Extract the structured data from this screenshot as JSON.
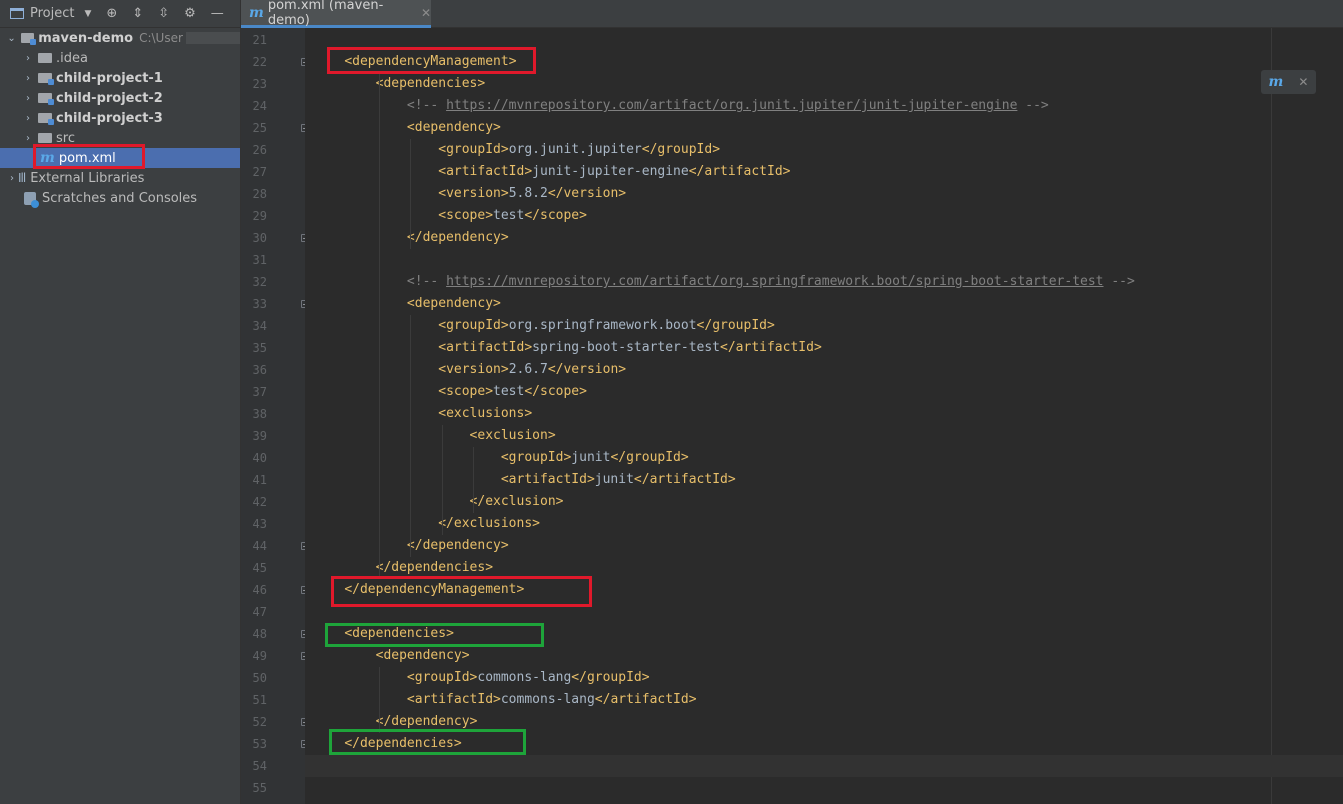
{
  "sidebar": {
    "header": {
      "title": "Project"
    },
    "root": {
      "name": "maven-demo",
      "path": "C:\\User"
    },
    "items": [
      {
        "label": ".idea"
      },
      {
        "label": "child-project-1"
      },
      {
        "label": "child-project-2"
      },
      {
        "label": "child-project-3"
      },
      {
        "label": "src"
      },
      {
        "label": "pom.xml"
      },
      {
        "label": "External Libraries"
      },
      {
        "label": "Scratches and Consoles"
      }
    ]
  },
  "editor": {
    "tab": {
      "label": "pom.xml (maven-demo)"
    },
    "lines": [
      {
        "num": "21",
        "text": ""
      },
      {
        "num": "22",
        "text": "    <dependencyManagement>"
      },
      {
        "num": "23",
        "text": "        <dependencies>"
      },
      {
        "num": "24",
        "text": "            <!-- https://mvnrepository.com/artifact/org.junit.jupiter/junit-jupiter-engine -->"
      },
      {
        "num": "25",
        "text": "            <dependency>"
      },
      {
        "num": "26",
        "text": "                <groupId>org.junit.jupiter</groupId>"
      },
      {
        "num": "27",
        "text": "                <artifactId>junit-jupiter-engine</artifactId>"
      },
      {
        "num": "28",
        "text": "                <version>5.8.2</version>"
      },
      {
        "num": "29",
        "text": "                <scope>test</scope>"
      },
      {
        "num": "30",
        "text": "            </dependency>"
      },
      {
        "num": "31",
        "text": ""
      },
      {
        "num": "32",
        "text": "            <!-- https://mvnrepository.com/artifact/org.springframework.boot/spring-boot-starter-test -->"
      },
      {
        "num": "33",
        "text": "            <dependency>"
      },
      {
        "num": "34",
        "text": "                <groupId>org.springframework.boot</groupId>"
      },
      {
        "num": "35",
        "text": "                <artifactId>spring-boot-starter-test</artifactId>"
      },
      {
        "num": "36",
        "text": "                <version>2.6.7</version>"
      },
      {
        "num": "37",
        "text": "                <scope>test</scope>"
      },
      {
        "num": "38",
        "text": "                <exclusions>"
      },
      {
        "num": "39",
        "text": "                    <exclusion>"
      },
      {
        "num": "40",
        "text": "                        <groupId>junit</groupId>"
      },
      {
        "num": "41",
        "text": "                        <artifactId>junit</artifactId>"
      },
      {
        "num": "42",
        "text": "                    </exclusion>"
      },
      {
        "num": "43",
        "text": "                </exclusions>"
      },
      {
        "num": "44",
        "text": "            </dependency>"
      },
      {
        "num": "45",
        "text": "        </dependencies>"
      },
      {
        "num": "46",
        "text": "    </dependencyManagement>"
      },
      {
        "num": "47",
        "text": ""
      },
      {
        "num": "48",
        "text": "    <dependencies>"
      },
      {
        "num": "49",
        "text": "        <dependency>"
      },
      {
        "num": "50",
        "text": "            <groupId>commons-lang</groupId>"
      },
      {
        "num": "51",
        "text": "            <artifactId>commons-lang</artifactId>"
      },
      {
        "num": "52",
        "text": "        </dependency>"
      },
      {
        "num": "53",
        "text": "    </dependencies>"
      },
      {
        "num": "54",
        "text": ""
      },
      {
        "num": "55",
        "text": ""
      }
    ]
  },
  "colors": {
    "tag": "#e8bf6a",
    "text": "#a9b7c6",
    "comment": "#808080",
    "highlight_red": "#e0192b",
    "highlight_green": "#1ea43a",
    "selection": "#4b6eaf"
  }
}
